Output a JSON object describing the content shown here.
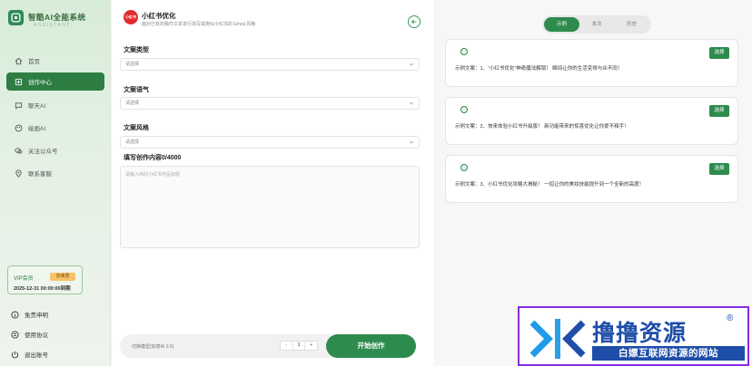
{
  "sidebar": {
    "brand_title": "智酷AI全能系统",
    "brand_subtitle": "ASSISTANT",
    "items": [
      {
        "label": "首页",
        "icon": "home-icon"
      },
      {
        "label": "创作中心",
        "icon": "create-icon"
      },
      {
        "label": "聊天AI",
        "icon": "chat-icon"
      },
      {
        "label": "绘画AI",
        "icon": "paint-icon"
      },
      {
        "label": "关注公众号",
        "icon": "wechat-icon"
      },
      {
        "label": "联系客服",
        "icon": "support-icon"
      }
    ],
    "vip": {
      "label": "VIP会员",
      "badge": "去续费",
      "expiry": "2025-12-31 00:00:00到期"
    },
    "footer": [
      {
        "label": "免责申明",
        "icon": "info-icon"
      },
      {
        "label": "使用协议",
        "icon": "document-icon"
      },
      {
        "label": "退出账号",
        "icon": "logout-icon"
      }
    ]
  },
  "tool": {
    "icon_text": "小红书",
    "title": "小红书优化",
    "description": "面对已有的稿件文本进行改写成类似小红书的 Emoji 风格"
  },
  "form": {
    "type_label": "文案类型",
    "type_placeholder": "请选择",
    "tone_label": "文案语气",
    "tone_placeholder": "请选择",
    "style_label": "文案风格",
    "style_placeholder": "请选择",
    "content_label": "填写创作内容0/4000",
    "content_placeholder": "请输入你的小红书作品标题"
  },
  "bottom": {
    "model_label": "切换模型(如意AI 3.5)",
    "stepper_minus": "-",
    "stepper_value": "1",
    "stepper_plus": "+",
    "start_button": "开始创作"
  },
  "right": {
    "tabs": [
      "示例",
      "本次",
      "历史"
    ],
    "active_tab": 0,
    "cards": [
      {
        "text": "示例文案：1、“小红书优化”神奇魔法解锁！ 瞬间让你的生活变得与众不同！",
        "button": "选择"
      },
      {
        "text": "示例文案：2、快来体验小红书升级版！ 新功能带来的惊喜优化让你爱不释手！",
        "button": "选择"
      },
      {
        "text": "示例文案：3、小红书优化攻略大揭秘！ 一招让你的美妆技能提升到一个全新的高度！",
        "button": "选择"
      }
    ]
  },
  "watermark": {
    "title": "撸撸资源",
    "reg_mark": "®",
    "slogan": "白嫖互联网资源的网站"
  },
  "colors": {
    "accent": "#2e8b4e",
    "tool_icon": "#e22b2b",
    "watermark_blue": "#1f4ea8",
    "watermark_border": "#8a2be2"
  }
}
